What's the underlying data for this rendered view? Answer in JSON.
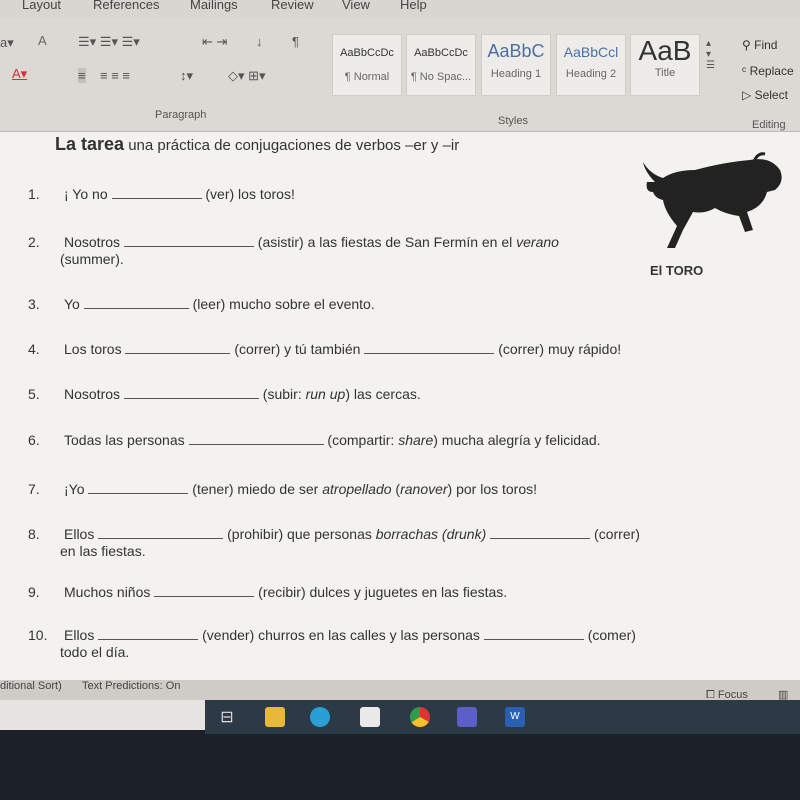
{
  "ribbon_tabs": [
    "Layout",
    "References",
    "Mailings",
    "Review",
    "View",
    "Help"
  ],
  "groups": {
    "paragraph": "Paragraph",
    "styles": "Styles",
    "editing": "Editing"
  },
  "styles": [
    {
      "preview": "AaBbCcDc",
      "name": "¶ Normal"
    },
    {
      "preview": "AaBbCcDc",
      "name": "¶ No Spac..."
    },
    {
      "preview": "AaBbC",
      "name": "Heading 1"
    },
    {
      "preview": "AaBbCcl",
      "name": "Heading 2"
    },
    {
      "preview": "AaB",
      "name": "Title"
    }
  ],
  "editing": {
    "find": "Find",
    "replace": "Replace",
    "select": "Select"
  },
  "doc": {
    "title_bold": "La tarea",
    "title_rest": "una práctica de conjugaciones de verbos –er y –ir",
    "image_caption": "El  TORO",
    "items": [
      {
        "n": "1.",
        "parts": [
          [
            "t",
            "¡ Yo no "
          ],
          [
            "b",
            90
          ],
          [
            "t",
            " (ver) los toros!"
          ]
        ]
      },
      {
        "n": "2.",
        "parts": [
          [
            "t",
            "Nosotros "
          ],
          [
            "b",
            130
          ],
          [
            "t",
            " (asistir) a las fiestas de San Fermín en el "
          ],
          [
            "i",
            "verano"
          ]
        ],
        "cont": "(summer)."
      },
      {
        "n": "3.",
        "parts": [
          [
            "t",
            "Yo "
          ],
          [
            "b",
            105
          ],
          [
            "t",
            " (leer) mucho sobre el evento."
          ]
        ]
      },
      {
        "n": "4.",
        "parts": [
          [
            "t",
            "Los toros "
          ],
          [
            "b",
            105
          ],
          [
            "t",
            " (correr) y tú también "
          ],
          [
            "b",
            130
          ],
          [
            "t",
            " (correr) muy rápido!"
          ]
        ]
      },
      {
        "n": "5.",
        "parts": [
          [
            "t",
            "Nosotros "
          ],
          [
            "b",
            135
          ],
          [
            "t",
            " (subir: "
          ],
          [
            "i",
            "run up"
          ],
          [
            "t",
            ") las cercas."
          ]
        ]
      },
      {
        "n": "6.",
        "parts": [
          [
            "t",
            "Todas las personas "
          ],
          [
            "b",
            135
          ],
          [
            "t",
            " (compartir: "
          ],
          [
            "i",
            "share"
          ],
          [
            "t",
            ") mucha alegría y felicidad."
          ]
        ]
      },
      {
        "n": "7.",
        "parts": [
          [
            "t",
            "¡Yo "
          ],
          [
            "b",
            100
          ],
          [
            "t",
            " (tener) miedo de ser "
          ],
          [
            "i",
            "atropellado"
          ],
          [
            "t",
            " ("
          ],
          [
            "i",
            "ranover"
          ],
          [
            "t",
            ") por los toros!"
          ]
        ]
      },
      {
        "n": "8.",
        "parts": [
          [
            "t",
            "Ellos "
          ],
          [
            "b",
            125
          ],
          [
            "t",
            " (prohibir) que personas "
          ],
          [
            "i",
            "borrachas (drunk)"
          ],
          [
            "t",
            " "
          ],
          [
            "b",
            100
          ],
          [
            "t",
            " (correr)"
          ]
        ],
        "cont": "en las fiestas."
      },
      {
        "n": "9.",
        "parts": [
          [
            "t",
            "Muchos niños "
          ],
          [
            "b",
            100
          ],
          [
            "t",
            " (recibir) dulces y juguetes en las fiestas."
          ]
        ]
      },
      {
        "n": "10.",
        "parts": [
          [
            "t",
            "Ellos "
          ],
          [
            "b",
            100
          ],
          [
            "t",
            " (vender) churros en las calles y las personas "
          ],
          [
            "b",
            100
          ],
          [
            "t",
            " (comer)"
          ]
        ],
        "cont": "todo el día."
      }
    ]
  },
  "status": {
    "left": "ditional Sort)",
    "predictions": "Text Predictions: On",
    "focus": "Focus"
  },
  "taskbar_icons": [
    "task-view",
    "file-explorer",
    "edge",
    "store",
    "chrome",
    "teams",
    "word"
  ]
}
